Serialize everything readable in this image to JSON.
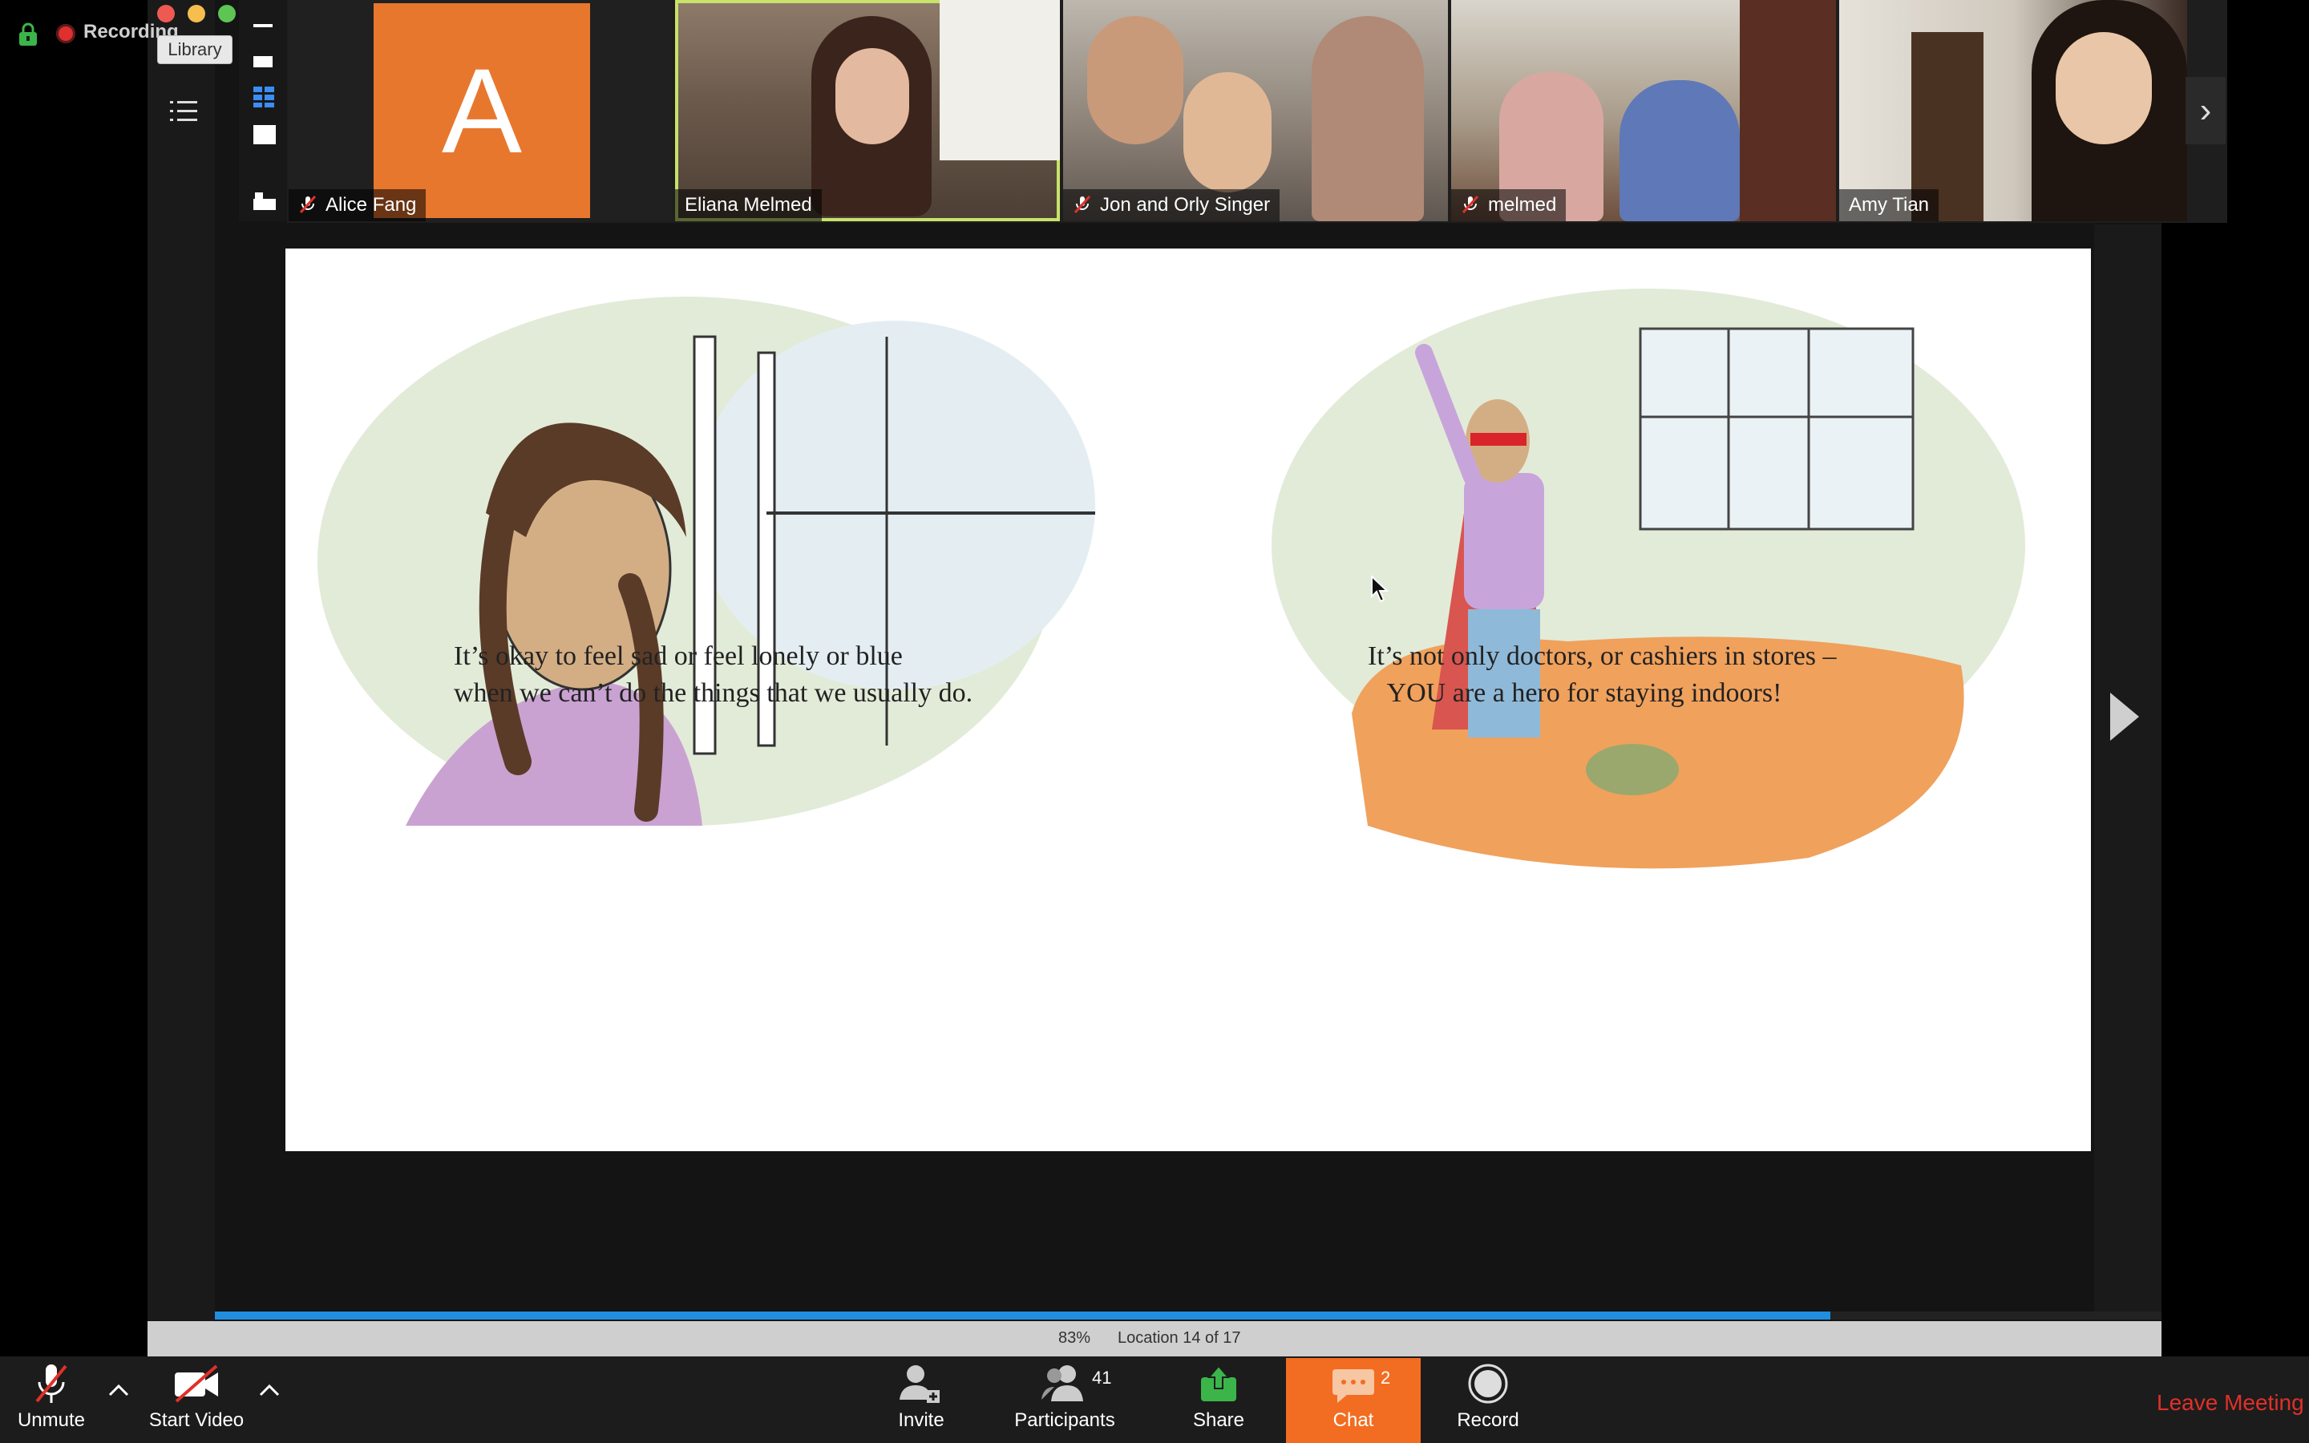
{
  "recording": {
    "label": "Recording"
  },
  "window": {
    "tooltip": "Library"
  },
  "participants": [
    {
      "name": "Alice Fang",
      "initial": "A",
      "muted": true,
      "avatar_color": "#E8772E"
    },
    {
      "name": "Eliana Melmed",
      "muted": false,
      "active_speaker": true
    },
    {
      "name": "Jon and Orly Singer",
      "muted": true
    },
    {
      "name": "melmed",
      "muted": true
    },
    {
      "name": "Amy Tian",
      "muted": false
    }
  ],
  "book": {
    "left_caption": [
      "It’s okay to feel sad or feel lonely or blue",
      "when we can’t do the things that we usually do."
    ],
    "right_caption": [
      "It’s not only doctors, or cashiers in stores –",
      "YOU are a hero for staying indoors!"
    ],
    "progress_percent": "83%",
    "progress_fraction": 0.83,
    "location": "Location 14 of 17"
  },
  "toolbar": {
    "unmute": "Unmute",
    "start_video": "Start Video",
    "invite": "Invite",
    "participants_label": "Participants",
    "participants_count": "41",
    "share": "Share",
    "chat": "Chat",
    "chat_count": "2",
    "record": "Record",
    "leave": "Leave Meeting"
  },
  "colors": {
    "accent_orange": "#F26D21",
    "share_green": "#3BB54A",
    "leave_red": "#E0302A",
    "progress_blue": "#1F8EE0",
    "speaker_highlight": "#C8E26A"
  }
}
